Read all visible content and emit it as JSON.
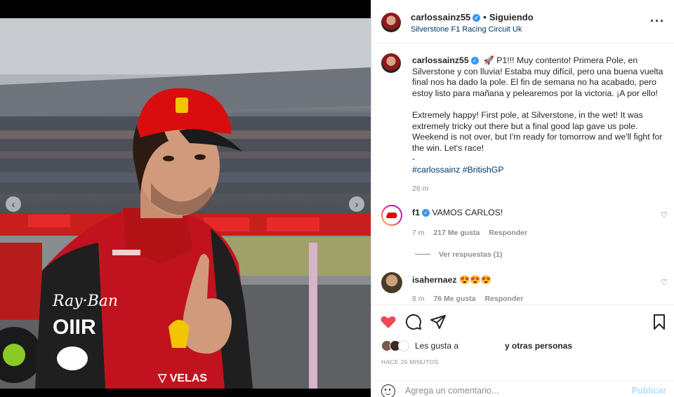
{
  "post": {
    "username": "carlossainz55",
    "follow_label": "Siguiendo",
    "location": "Silverstone F1 Racing Circuit Uk",
    "more_icon": "more-options-icon",
    "caption_spanish": "P1!!! Muy contento! Primera Pole, en Silverstone y con lluvia! Estaba muy difícil, pero una buena vuelta final nos ha dado la pole. El fin de semana no ha acabado, pero estoy listo para mañana y pelearemos por la victoria. ¡A por ello!",
    "caption_english": "Extremely happy! First pole, at Silverstone, in the wet! It was extremely tricky out there but a final good lap gave us pole. Weekend is not over, but I'm ready for tomorrow and we'll fight for the win. Let's race!",
    "caption_dash": "-",
    "hashtags": "#carlossainz #BritishGP",
    "caption_emoji": "🚀",
    "time": "26 m"
  },
  "comments": [
    {
      "username": "f1",
      "text": "VAMOS CARLOS!",
      "time": "7 m",
      "likes": "217 Me gusta",
      "reply_label": "Responder",
      "view_replies": "Ver respuestas (1)"
    },
    {
      "username": "isahernaez",
      "text": "😍😍😍",
      "time": "8 m",
      "likes": "76 Me gusta",
      "reply_label": "Responder"
    }
  ],
  "actions": {
    "likes_prefix": "Les gusta a",
    "likes_suffix": "y otras personas",
    "time_ago": "HACE 26 MINUTOS",
    "comment_placeholder": "Agrega un comentario...",
    "publish_label": "Publicar"
  },
  "colors": {
    "like_red": "#ed4956",
    "link_blue": "#00376b",
    "verified_blue": "#3897f0",
    "ferrari_red": "#d40000"
  }
}
